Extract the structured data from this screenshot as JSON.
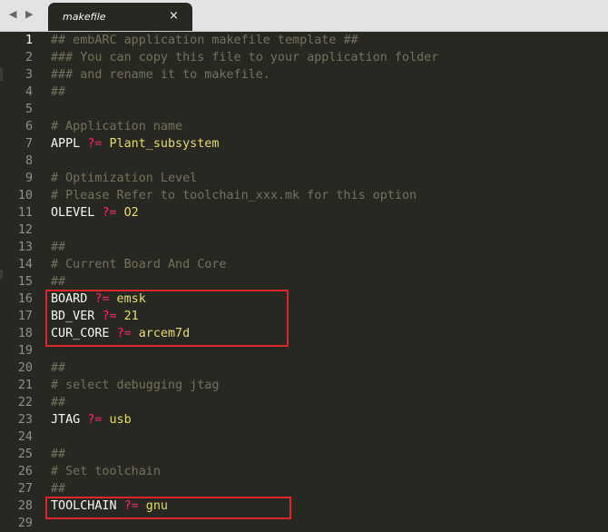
{
  "nav": {
    "arrows": "◀ ▶"
  },
  "tab": {
    "title": "makefile",
    "close": "×"
  },
  "lines": [
    {
      "num": "1",
      "parts": [
        {
          "t": "## embARC application makefile template ##",
          "c": "cm"
        }
      ]
    },
    {
      "num": "2",
      "parts": [
        {
          "t": "### You can copy this file to your application folder",
          "c": "cm"
        }
      ]
    },
    {
      "num": "3",
      "parts": [
        {
          "t": "### and rename it to makefile.",
          "c": "cm"
        }
      ]
    },
    {
      "num": "4",
      "parts": [
        {
          "t": "##",
          "c": "cm"
        }
      ]
    },
    {
      "num": "5",
      "parts": []
    },
    {
      "num": "6",
      "parts": [
        {
          "t": "# Application name",
          "c": "cm"
        }
      ]
    },
    {
      "num": "7",
      "parts": [
        {
          "t": "APPL ",
          "c": "tx"
        },
        {
          "t": "?=",
          "c": "op"
        },
        {
          "t": " Plant_subsystem",
          "c": "val"
        }
      ]
    },
    {
      "num": "8",
      "parts": []
    },
    {
      "num": "9",
      "parts": [
        {
          "t": "# Optimization Level",
          "c": "cm"
        }
      ]
    },
    {
      "num": "10",
      "parts": [
        {
          "t": "# Please Refer to toolchain_xxx.mk for this option",
          "c": "cm"
        }
      ]
    },
    {
      "num": "11",
      "parts": [
        {
          "t": "OLEVEL ",
          "c": "tx"
        },
        {
          "t": "?=",
          "c": "op"
        },
        {
          "t": " O2",
          "c": "val"
        }
      ]
    },
    {
      "num": "12",
      "parts": []
    },
    {
      "num": "13",
      "parts": [
        {
          "t": "##",
          "c": "cm"
        }
      ]
    },
    {
      "num": "14",
      "parts": [
        {
          "t": "# Current Board And Core",
          "c": "cm"
        }
      ]
    },
    {
      "num": "15",
      "parts": [
        {
          "t": "##",
          "c": "cm"
        }
      ]
    },
    {
      "num": "16",
      "parts": [
        {
          "t": "BOARD ",
          "c": "tx"
        },
        {
          "t": "?=",
          "c": "op"
        },
        {
          "t": " emsk",
          "c": "val"
        }
      ]
    },
    {
      "num": "17",
      "parts": [
        {
          "t": "BD_VER ",
          "c": "tx"
        },
        {
          "t": "?=",
          "c": "op"
        },
        {
          "t": " 21",
          "c": "val"
        }
      ]
    },
    {
      "num": "18",
      "parts": [
        {
          "t": "CUR_CORE ",
          "c": "tx"
        },
        {
          "t": "?=",
          "c": "op"
        },
        {
          "t": " arcem7d",
          "c": "val"
        }
      ]
    },
    {
      "num": "19",
      "parts": []
    },
    {
      "num": "20",
      "parts": [
        {
          "t": "##",
          "c": "cm"
        }
      ]
    },
    {
      "num": "21",
      "parts": [
        {
          "t": "# select debugging jtag",
          "c": "cm"
        }
      ]
    },
    {
      "num": "22",
      "parts": [
        {
          "t": "##",
          "c": "cm"
        }
      ]
    },
    {
      "num": "23",
      "parts": [
        {
          "t": "JTAG ",
          "c": "tx"
        },
        {
          "t": "?=",
          "c": "op"
        },
        {
          "t": " usb",
          "c": "val"
        }
      ]
    },
    {
      "num": "24",
      "parts": []
    },
    {
      "num": "25",
      "parts": [
        {
          "t": "##",
          "c": "cm"
        }
      ]
    },
    {
      "num": "26",
      "parts": [
        {
          "t": "# Set toolchain",
          "c": "cm"
        }
      ]
    },
    {
      "num": "27",
      "parts": [
        {
          "t": "##",
          "c": "cm"
        }
      ]
    },
    {
      "num": "28",
      "parts": [
        {
          "t": "TOOLCHAIN ",
          "c": "tx"
        },
        {
          "t": "?=",
          "c": "op"
        },
        {
          "t": " gnu",
          "c": "val"
        }
      ]
    },
    {
      "num": "29",
      "parts": []
    }
  ],
  "active_line": "1",
  "colors": {
    "background": "#272822",
    "comment": "#75715e",
    "operator": "#f92672",
    "value": "#e6db74",
    "text": "#f8f8f2",
    "highlight_box": "#e0252c"
  }
}
